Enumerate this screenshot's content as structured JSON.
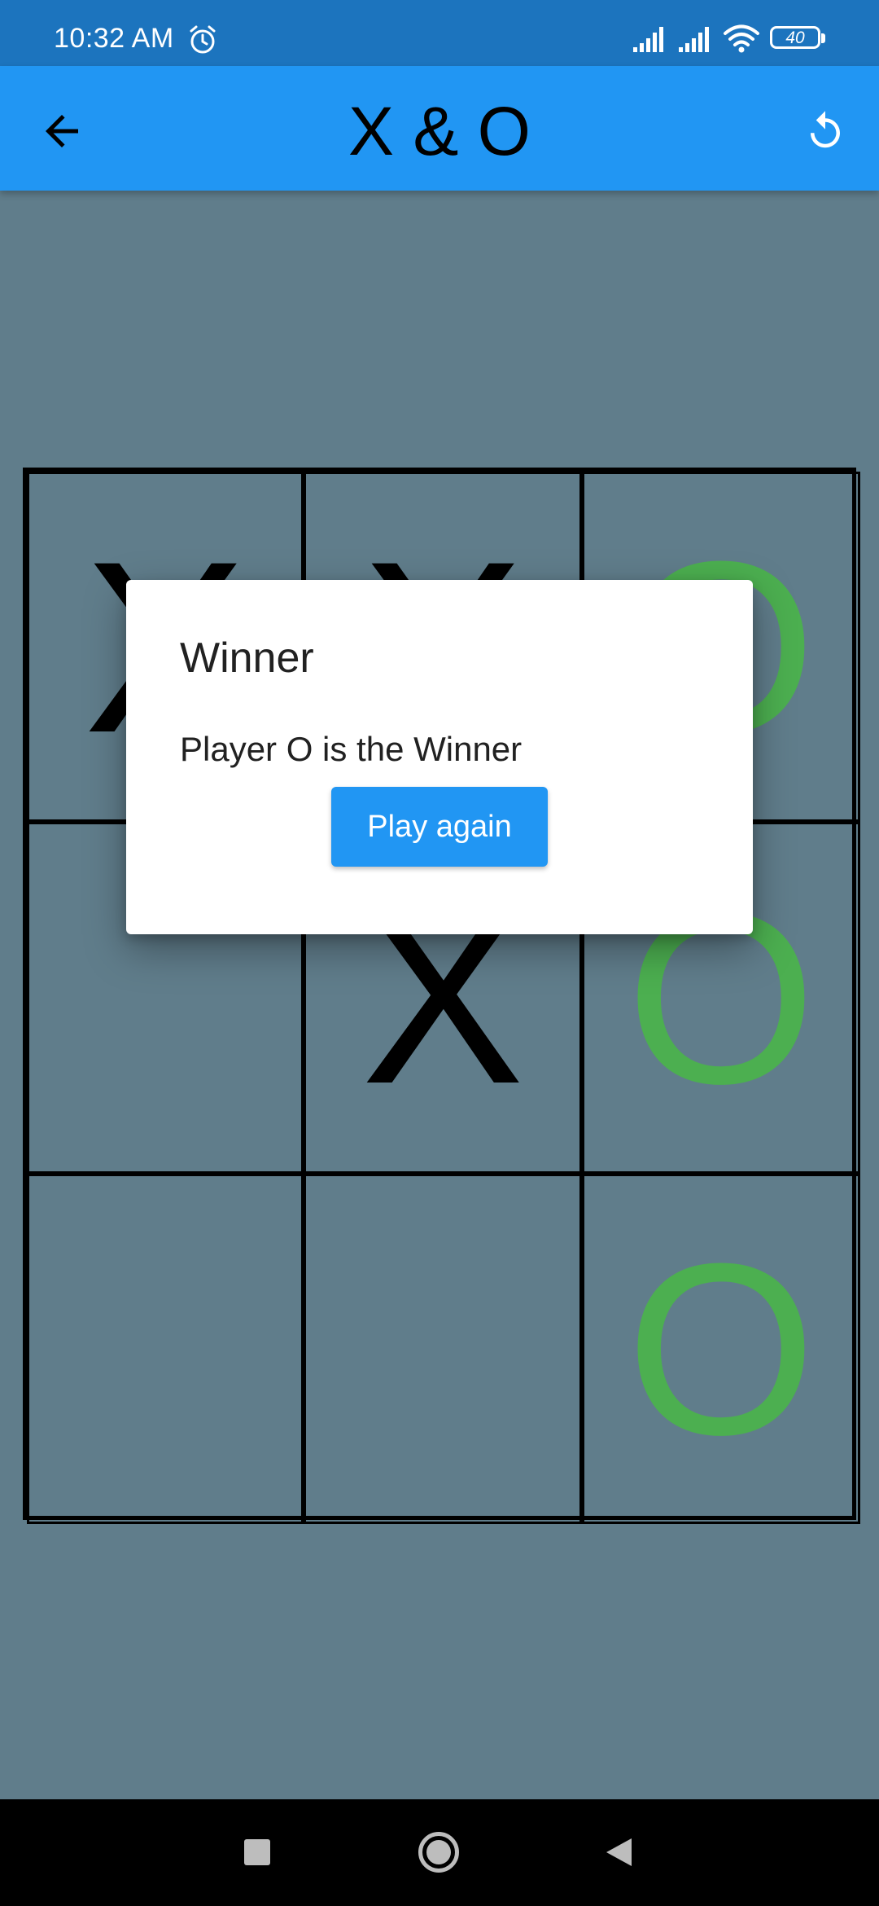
{
  "status_bar": {
    "time": "10:32 AM",
    "battery_level": "40",
    "icons": [
      "alarm-icon",
      "signal-icon",
      "signal-icon",
      "wifi-icon",
      "battery-icon"
    ]
  },
  "app_bar": {
    "title": "X & O",
    "back_icon": "arrow-left-icon",
    "refresh_icon": "refresh-icon",
    "background_color": "#2196f3"
  },
  "board": {
    "cells": [
      "X",
      "X",
      "O",
      "",
      "X",
      "O",
      "",
      "",
      "O"
    ],
    "x_color": "#000000",
    "o_color": "#4caf50",
    "background_color": "#607d8b"
  },
  "dialog": {
    "title": "Winner",
    "message": "Player O is the Winner",
    "button_label": "Play again",
    "button_color": "#2196f3"
  },
  "nav_bar": {
    "icons": [
      "recents-square-icon",
      "home-circle-icon",
      "back-triangle-icon"
    ]
  }
}
